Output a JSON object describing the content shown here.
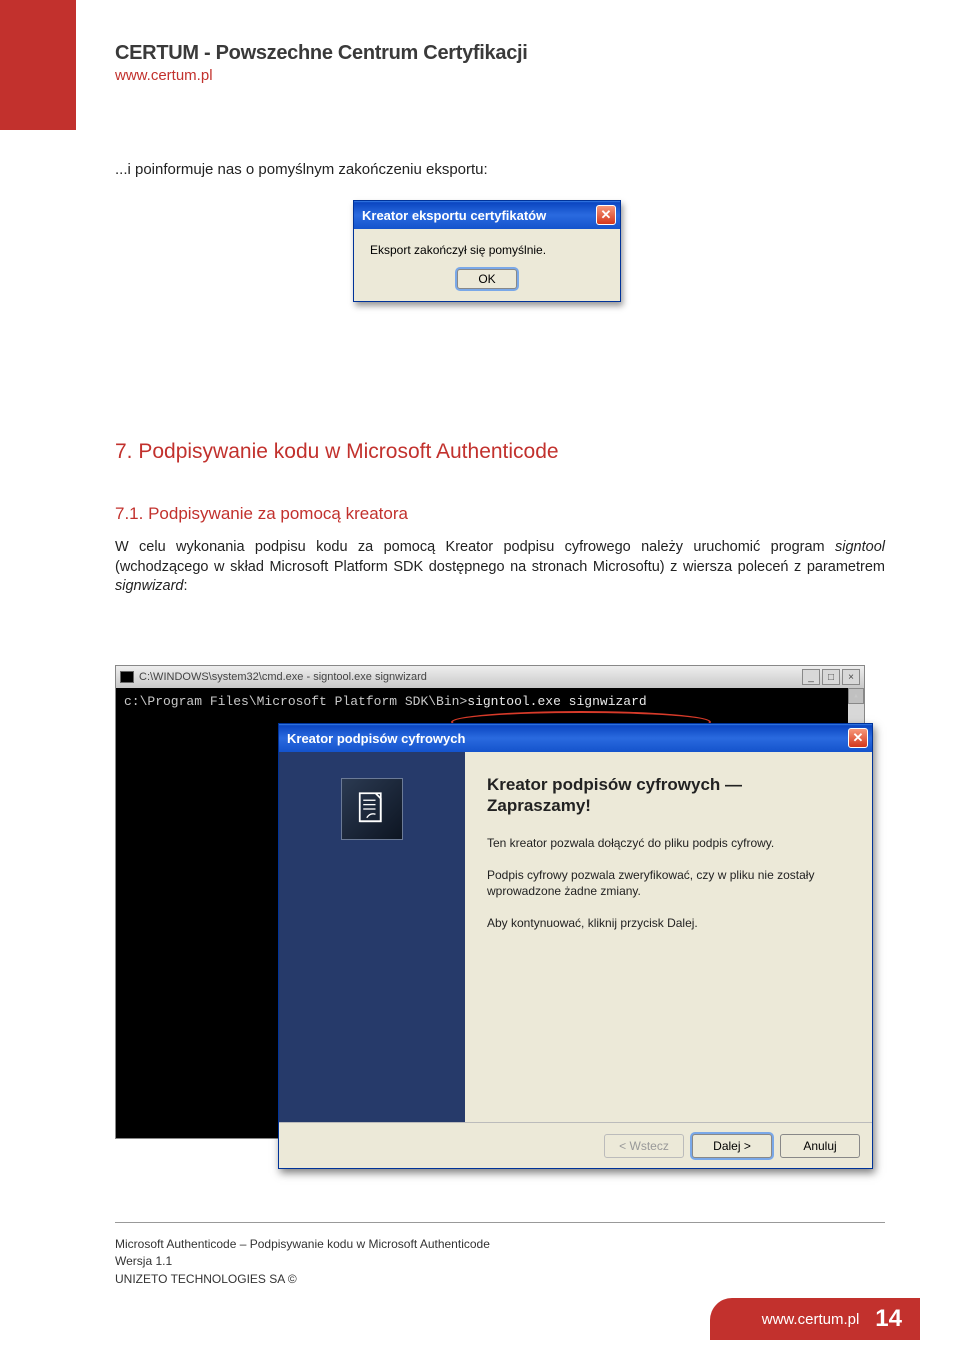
{
  "header": {
    "title": "CERTUM - Powszechne Centrum Certyfikacji",
    "url": "www.certum.pl"
  },
  "intro_text": "...i poinformuje nas o pomyślnym zakończeniu eksportu:",
  "dialog_export": {
    "title": "Kreator eksportu certyfikatów",
    "message": "Eksport zakończył się pomyślnie.",
    "ok_label": "OK"
  },
  "section7": {
    "heading": "7. Podpisywanie kodu w Microsoft Authenticode"
  },
  "section71": {
    "heading": "7.1.  Podpisywanie za pomocą kreatora",
    "para_pre": "W celu wykonania podpisu kodu za pomocą Kreator podpisu cyfrowego należy uruchomić program ",
    "em1": "signtool",
    "para_mid": " (wchodzącego w skład Microsoft Platform SDK dostępnego na stronach Microsoftu) z wiersza poleceń z parametrem ",
    "em2": "signwizard",
    "para_post": ":"
  },
  "cmd": {
    "title": "C:\\WINDOWS\\system32\\cmd.exe - signtool.exe signwizard",
    "prompt_path": "c:\\Program Files\\Microsoft Platform SDK\\Bin>",
    "command": "signtool.exe signwizard"
  },
  "dialog_wizard": {
    "title": "Kreator podpisów cyfrowych",
    "heading": "Kreator podpisów cyfrowych — Zapraszamy!",
    "p1": "Ten kreator pozwala dołączyć do pliku podpis cyfrowy.",
    "p2": "Podpis cyfrowy pozwala zweryfikować, czy w pliku nie zostały wprowadzone żadne zmiany.",
    "p3": "Aby kontynuować, kliknij przycisk Dalej.",
    "btn_back": "< Wstecz",
    "btn_next": "Dalej >",
    "btn_cancel": "Anuluj"
  },
  "footer": {
    "line1": "Microsoft Authenticode  – Podpisywanie kodu w Microsoft Authenticode",
    "line2": "Wersja 1.1",
    "line3": "UNIZETO TECHNOLOGIES SA ©",
    "url": "www.certum.pl",
    "page_number": "14"
  }
}
